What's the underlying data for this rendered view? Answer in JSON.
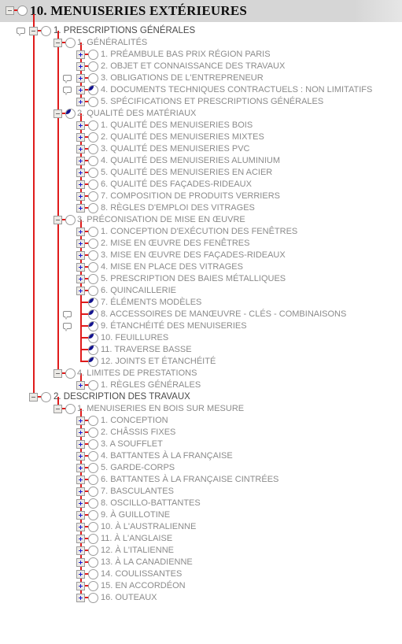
{
  "header": {
    "title": "10. MENUISERIES EXTÉRIEURES",
    "band_color": "#d6d6d6",
    "text_color": "#0e0e0e"
  },
  "colors": {
    "connector_red": "#e01b1b",
    "toggle_plus_blue": "#1a1ad0",
    "pie_blue": "#13138f",
    "label_gray": "#8b8b8b",
    "label_dark": "#4a4a4a"
  },
  "tree": {
    "root": {
      "label": "10. MENUISERIES EXTÉRIEURES",
      "state": "expanded"
    },
    "nodes": [
      {
        "label": "1. PRESCRIPTIONS GÉNÉRALES",
        "level": 1,
        "toggle": "minus",
        "pie": false,
        "comment": true
      },
      {
        "label": "1. GÉNÉRALITÉS",
        "level": 2,
        "toggle": "minus",
        "pie": false,
        "comment": false
      },
      {
        "label": "1. PRÉAMBULE BAS PRIX RÉGION PARIS",
        "level": 3,
        "toggle": "plus",
        "pie": false,
        "comment": false
      },
      {
        "label": "2. OBJET ET CONNAISSANCE DES TRAVAUX",
        "level": 3,
        "toggle": "plus",
        "pie": false,
        "comment": false
      },
      {
        "label": "3. OBLIGATIONS DE L'ENTREPRENEUR",
        "level": 3,
        "toggle": "plus",
        "pie": false,
        "comment": true
      },
      {
        "label": "4. DOCUMENTS TECHNIQUES CONTRACTUELS : NON LIMITATIFS",
        "level": 3,
        "toggle": "plus",
        "pie": true,
        "comment": true
      },
      {
        "label": "5. SPÉCIFICATIONS ET PRESCRIPTIONS GÉNÉRALES",
        "level": 3,
        "toggle": "plus",
        "pie": false,
        "comment": false
      },
      {
        "label": "2. QUALITÉ DES MATÉRIAUX",
        "level": 2,
        "toggle": "minus",
        "pie": true,
        "comment": false
      },
      {
        "label": "1. QUALITÉ DES MENUISERIES BOIS",
        "level": 3,
        "toggle": "plus",
        "pie": false,
        "comment": false
      },
      {
        "label": "2. QUALITÉ DES MENUISERIES MIXTES",
        "level": 3,
        "toggle": "plus",
        "pie": false,
        "comment": false
      },
      {
        "label": "3. QUALITÉ DES MENUISERIES PVC",
        "level": 3,
        "toggle": "plus",
        "pie": false,
        "comment": false
      },
      {
        "label": "4. QUALITÉ DES MENUISERIES ALUMINIUM",
        "level": 3,
        "toggle": "plus",
        "pie": false,
        "comment": false
      },
      {
        "label": "5. QUALITÉ DES MENUISERIES EN ACIER",
        "level": 3,
        "toggle": "plus",
        "pie": false,
        "comment": false
      },
      {
        "label": "6. QUALITÉ DES FAÇADES-RIDEAUX",
        "level": 3,
        "toggle": "plus",
        "pie": false,
        "comment": false
      },
      {
        "label": "7. COMPOSITION DE PRODUITS VERRIERS",
        "level": 3,
        "toggle": "plus",
        "pie": false,
        "comment": false
      },
      {
        "label": "8. RÈGLES D'EMPLOI DES VITRAGES",
        "level": 3,
        "toggle": "plus",
        "pie": false,
        "comment": false
      },
      {
        "label": "3. PRÉCONISATION DE MISE EN ŒUVRE",
        "level": 2,
        "toggle": "minus",
        "pie": false,
        "comment": false
      },
      {
        "label": "1. CONCEPTION D'EXÉCUTION DES FENÊTRES",
        "level": 3,
        "toggle": "plus",
        "pie": false,
        "comment": false
      },
      {
        "label": "2. MISE EN ŒUVRE DES FENÊTRES",
        "level": 3,
        "toggle": "plus",
        "pie": false,
        "comment": false
      },
      {
        "label": "3. MISE EN ŒUVRE DES FAÇADES-RIDEAUX",
        "level": 3,
        "toggle": "plus",
        "pie": false,
        "comment": false
      },
      {
        "label": "4. MISE EN PLACE DES VITRAGES",
        "level": 3,
        "toggle": "plus",
        "pie": false,
        "comment": false
      },
      {
        "label": "5. PRESCRIPTION DES BAIES MÉTALLIQUES",
        "level": 3,
        "toggle": "plus",
        "pie": false,
        "comment": false
      },
      {
        "label": "6. QUINCAILLERIE",
        "level": 3,
        "toggle": "plus",
        "pie": false,
        "comment": false
      },
      {
        "label": "7. ÉLÉMENTS MODÈLES",
        "level": 3,
        "toggle": "none",
        "pie": true,
        "comment": false
      },
      {
        "label": "8. ACCESSOIRES DE MANŒUVRE - CLÉS - COMBINAISONS",
        "level": 3,
        "toggle": "none",
        "pie": true,
        "comment": true
      },
      {
        "label": "9. ÉTANCHÉITÉ DES MENUISERIES",
        "level": 3,
        "toggle": "none",
        "pie": true,
        "comment": true
      },
      {
        "label": "10. FEUILLURES",
        "level": 3,
        "toggle": "none",
        "pie": true,
        "comment": false
      },
      {
        "label": "11. TRAVERSE BASSE",
        "level": 3,
        "toggle": "none",
        "pie": true,
        "comment": false
      },
      {
        "label": "12. JOINTS ET ÉTANCHÉITÉ",
        "level": 3,
        "toggle": "none",
        "pie": true,
        "comment": false
      },
      {
        "label": "4. LIMITES DE PRESTATIONS",
        "level": 2,
        "toggle": "minus",
        "pie": false,
        "comment": false
      },
      {
        "label": "1. RÈGLES GÉNÉRALES",
        "level": 3,
        "toggle": "plus",
        "pie": false,
        "comment": false
      },
      {
        "label": "2. DESCRIPTION DES TRAVAUX",
        "level": 1,
        "toggle": "minus",
        "pie": false,
        "comment": false
      },
      {
        "label": "1. MENUISERIES EN BOIS SUR MESURE",
        "level": 2,
        "toggle": "minus",
        "pie": false,
        "comment": false
      },
      {
        "label": "1. CONCEPTION",
        "level": 3,
        "toggle": "plus",
        "pie": false,
        "comment": false
      },
      {
        "label": "2. CHÂSSIS FIXES",
        "level": 3,
        "toggle": "plus",
        "pie": false,
        "comment": false
      },
      {
        "label": "3. A SOUFFLET",
        "level": 3,
        "toggle": "plus",
        "pie": false,
        "comment": false
      },
      {
        "label": "4. BATTANTES À LA FRANÇAISE",
        "level": 3,
        "toggle": "plus",
        "pie": false,
        "comment": false
      },
      {
        "label": "5. GARDE-CORPS",
        "level": 3,
        "toggle": "plus",
        "pie": false,
        "comment": false
      },
      {
        "label": "6. BATTANTES À LA FRANÇAISE CINTRÉES",
        "level": 3,
        "toggle": "plus",
        "pie": false,
        "comment": false
      },
      {
        "label": "7. BASCULANTES",
        "level": 3,
        "toggle": "plus",
        "pie": false,
        "comment": false
      },
      {
        "label": "8. OSCILLO-BATTANTES",
        "level": 3,
        "toggle": "plus",
        "pie": false,
        "comment": false
      },
      {
        "label": "9. À GUILLOTINE",
        "level": 3,
        "toggle": "plus",
        "pie": false,
        "comment": false
      },
      {
        "label": "10. À L'AUSTRALIENNE",
        "level": 3,
        "toggle": "plus",
        "pie": false,
        "comment": false
      },
      {
        "label": "11. À L'ANGLAISE",
        "level": 3,
        "toggle": "plus",
        "pie": false,
        "comment": false
      },
      {
        "label": "12. À L'ITALIENNE",
        "level": 3,
        "toggle": "plus",
        "pie": false,
        "comment": false
      },
      {
        "label": "13. À LA CANADIENNE",
        "level": 3,
        "toggle": "plus",
        "pie": false,
        "comment": false
      },
      {
        "label": "14. COULISSANTES",
        "level": 3,
        "toggle": "plus",
        "pie": false,
        "comment": false
      },
      {
        "label": "15. EN ACCORDÉON",
        "level": 3,
        "toggle": "plus",
        "pie": false,
        "comment": false
      },
      {
        "label": "16. OUTEAUX",
        "level": 3,
        "toggle": "plus",
        "pie": false,
        "comment": false
      }
    ]
  }
}
